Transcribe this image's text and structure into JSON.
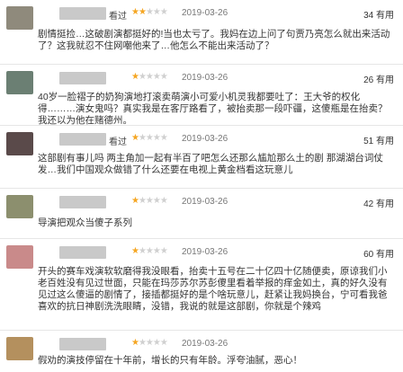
{
  "reviews": [
    {
      "status": "看过",
      "rating": 2,
      "date": "2019-03-26",
      "votes": "34",
      "votes_unit": "有用",
      "comment": "剧情挺捡…这破剧演都挺好的!当也太亏了。我妈在边上问了句贾乃亮怎么就出来活动了？这我就忍不住网嘲他来了…他怎么不能出来活动了？",
      "avatar_color": "#8f8a7c"
    },
    {
      "status": "",
      "rating": 1,
      "date": "2019-03-26",
      "votes": "26",
      "votes_unit": "有用",
      "comment": "40岁一脸褶子的奶狗演地打滚卖萌演小可爱小机灵我都要吐了：王大爷的权化得………演女鬼吗？真实我是在客厅路看了，被抬卖那一段吓疆，这傻瓶是在抬卖？我还以为他在赌德州。",
      "avatar_color": "#6b7f73"
    },
    {
      "status": "看过",
      "rating": 1,
      "date": "2019-03-26",
      "votes": "51",
      "votes_unit": "有用",
      "comment": "这部剧有事儿吗 两主角加一起有半百了吧怎么还那么尴尬那么土的剧 那湖湖台词仗发…我们中国观众做错了什么还要在电视上黄金档看这玩意儿",
      "avatar_color": "#5a4a4a"
    },
    {
      "status": "",
      "rating": 1,
      "date": "2019-03-26",
      "votes": "42",
      "votes_unit": "有用",
      "comment": "导演把观众当傻子系列",
      "avatar_color": "#8c8f6e"
    },
    {
      "status": "",
      "rating": 1,
      "date": "2019-03-26",
      "votes": "60",
      "votes_unit": "有用",
      "comment": "开头的赛车戏演软软磨得我没眼看，抬卖十五号在二十亿四十亿随便卖，原谅我们小老百姓没有见过世面，只能在玛莎苏尔苏彭傻里看着举报的痒金如土，真的好久没有见过这么傻逼的剧情了，接插都挺好的是个啥玩意儿，赶紧让我妈换台，宁可看我爸喜欢的抗日神剧洗洗眼睛，没错，我说的就是这部剧，你就是个辣鸡",
      "avatar_color": "#c98a8a"
    },
    {
      "status": "",
      "rating": 1,
      "date": "2019-03-26",
      "votes": "",
      "votes_unit": "",
      "comment": "假劝的演技停留在十年前，增长的只有年龄。浮夸油腻，恶心！",
      "avatar_color": "#b4905e"
    }
  ]
}
